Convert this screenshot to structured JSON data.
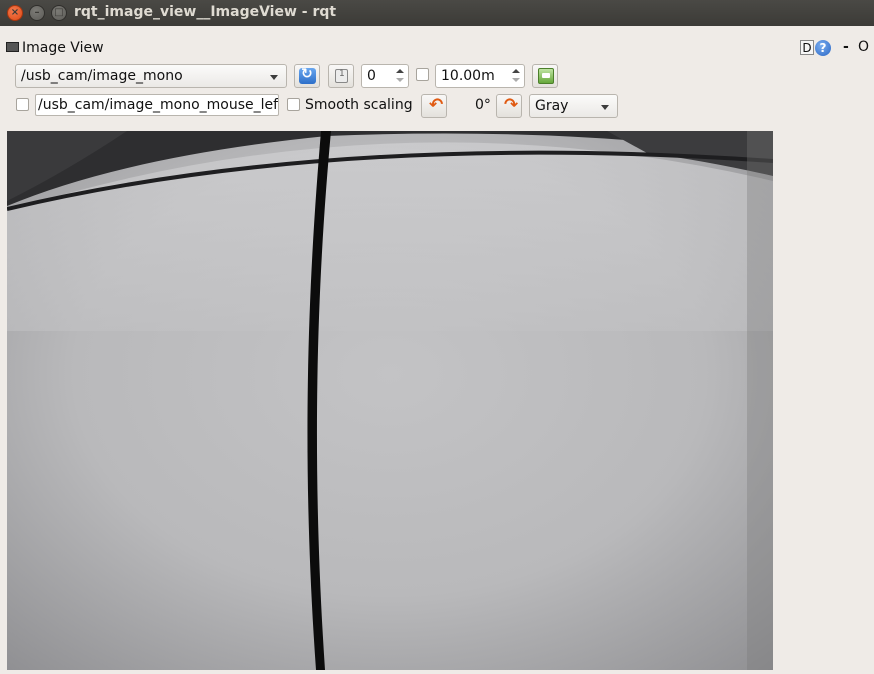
{
  "window": {
    "title": "rqt_image_view__ImageView - rqt",
    "close_glyph": "×",
    "min_glyph": "–",
    "max_glyph": "□"
  },
  "dock": {
    "title": "Image View",
    "d_label": "D",
    "help_label": "?",
    "minimize_label": "-",
    "close_label": "O"
  },
  "toolbar": {
    "topic": "/usb_cam/image_mono",
    "num_gridlines": "0",
    "dynamic_range_max": "10.00m",
    "mouse_topic": "/usb_cam/image_mono_mouse_left",
    "smooth_scaling_label": "Smooth scaling",
    "rotation_label": "0°",
    "color_scheme": "Gray"
  },
  "colors": {
    "accent_blue": "#2d6fc9",
    "rotate_orange": "#e05a12",
    "titlebar": "#3c3b37",
    "panel_bg": "#efebe7"
  }
}
